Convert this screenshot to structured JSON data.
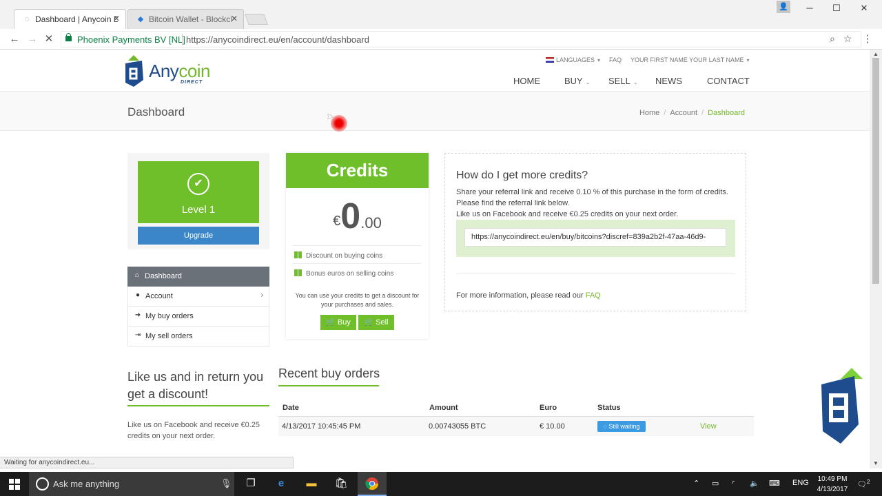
{
  "browser": {
    "tabs": [
      {
        "title": "Dashboard | Anycoin Dire",
        "active": true
      },
      {
        "title": "Bitcoin Wallet - Blockcha",
        "active": false
      }
    ],
    "cert_name": "Phoenix Payments BV [NL]",
    "url": "https://anycoindirect.eu/en/account/dashboard",
    "status_text": "Waiting for anycoindirect.eu..."
  },
  "site": {
    "logo": {
      "main_a": "Any",
      "main_b": "coin",
      "sub": "DIRECT"
    },
    "topnav": {
      "languages": "LANGUAGES",
      "faq": "FAQ",
      "user": "YOUR FIRST NAME YOUR LAST NAME"
    },
    "mainnav": {
      "home": "HOME",
      "buy": "BUY",
      "sell": "SELL",
      "news": "NEWS",
      "contact": "CONTACT"
    },
    "page_title": "Dashboard",
    "breadcrumb": {
      "home": "Home",
      "account": "Account",
      "current": "Dashboard"
    },
    "level": {
      "label": "Level 1",
      "upgrade": "Upgrade"
    },
    "sidemenu": [
      {
        "label": "Dashboard",
        "icon": "home-icon"
      },
      {
        "label": "Account",
        "icon": "user-icon"
      },
      {
        "label": "My buy orders",
        "icon": "sign-in-icon"
      },
      {
        "label": "My sell orders",
        "icon": "sign-out-icon"
      }
    ],
    "credits": {
      "title": "Credits",
      "currency": "€",
      "integer": "0",
      "decimal": ".00",
      "perk_buy": "Discount on buying coins",
      "perk_sell": "Bonus euros on selling coins",
      "note": "You can use your credits to get a discount for your purchases and sales.",
      "buy_label": "Buy",
      "sell_label": "Sell"
    },
    "how": {
      "title": "How do I get more credits?",
      "text1": "Share your referral link and receive 0.10 % of this purchase in the form of credits. Please find the referral link below.",
      "text2": "Like us on Facebook and receive €0.25 credits on your next order.",
      "ref_link": "https://anycoindirect.eu/en/buy/bitcoins?discref=839a2b2f-47aa-46d9-",
      "more_info": "For more information, please read our",
      "faq_link": "FAQ"
    },
    "like": {
      "title": "Like us and in return you get a discount!",
      "text": "Like us on Facebook and receive €0.25 credits on your next order."
    },
    "recent": {
      "title": "Recent buy orders",
      "columns": [
        "Date",
        "Amount",
        "Euro",
        "Status"
      ],
      "rows": [
        {
          "date": "4/13/2017 10:45:45 PM",
          "amount": "0.00743055 BTC",
          "euro": "€ 10.00",
          "status": "Still waiting",
          "action": "View"
        }
      ]
    }
  },
  "taskbar": {
    "search_placeholder": "Ask me anything",
    "lang": "ENG",
    "time": "10:49 PM",
    "date": "4/13/2017",
    "notifications": "2"
  },
  "colors": {
    "brand_green": "#6fbf2a",
    "brand_blue": "#1e4c8c",
    "button_blue": "#3b86c8"
  }
}
